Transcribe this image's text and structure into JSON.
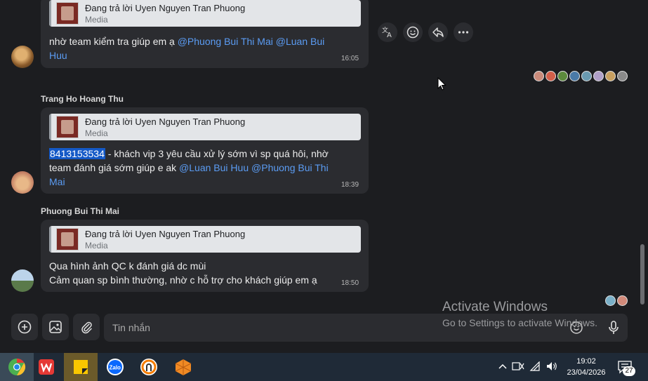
{
  "messages": [
    {
      "sender": "",
      "quote": {
        "title": "Đang trả lời Uyen Nguyen Tran Phuong",
        "subtitle": "Media"
      },
      "text_prefix": "nhờ team kiểm tra giúp em ạ ",
      "mentions": [
        "@Phuong Bui Thi Mai",
        "@Luan Bui",
        "Huu"
      ],
      "time": "16:05"
    },
    {
      "sender": "Trang Ho Hoang Thu",
      "quote": {
        "title": "Đang trả lời Uyen Nguyen Tran Phuong",
        "subtitle": "Media"
      },
      "highlight": "8413153534",
      "text_line1": " - khách vip 3 yêu cầu xử lý sớm vì sp quá hôi, nhờ",
      "text_line2": "team đánh giá sớm giúp e ak ",
      "mentions": [
        "@Luan Bui Huu",
        "@Phuong Bui Thi",
        "Mai"
      ],
      "time": "18:39"
    },
    {
      "sender": "Phuong Bui Thi Mai",
      "quote": {
        "title": "Đang trả lời Uyen Nguyen Tran Phuong",
        "subtitle": "Media"
      },
      "text_line1": "Qua hình ảnh QC k đánh giá dc mùi",
      "text_line2": "Cảm quan sp bình thường, nhờ c hỗ trợ cho khách giúp em ạ",
      "time": "18:50"
    }
  ],
  "message_actions": [
    "translate-icon",
    "emoji-icon",
    "reply-icon",
    "more-icon"
  ],
  "composer": {
    "placeholder": "Tin nhắn"
  },
  "watermark": {
    "title": "Activate Windows",
    "subtitle": "Go to Settings to activate Windows."
  },
  "taskbar": {
    "apps": [
      "chrome-icon",
      "wps-icon",
      "sticky-notes-icon",
      "zalo-icon",
      "teamviewer-icon",
      "app-icon"
    ],
    "time": "19:02",
    "date": "23/04/2026",
    "notifications": "27"
  },
  "colors": {
    "mention": "#5b9cf3",
    "highlight": "#1459c7",
    "background": "#1c1d20",
    "bubble": "#2b2c30"
  }
}
